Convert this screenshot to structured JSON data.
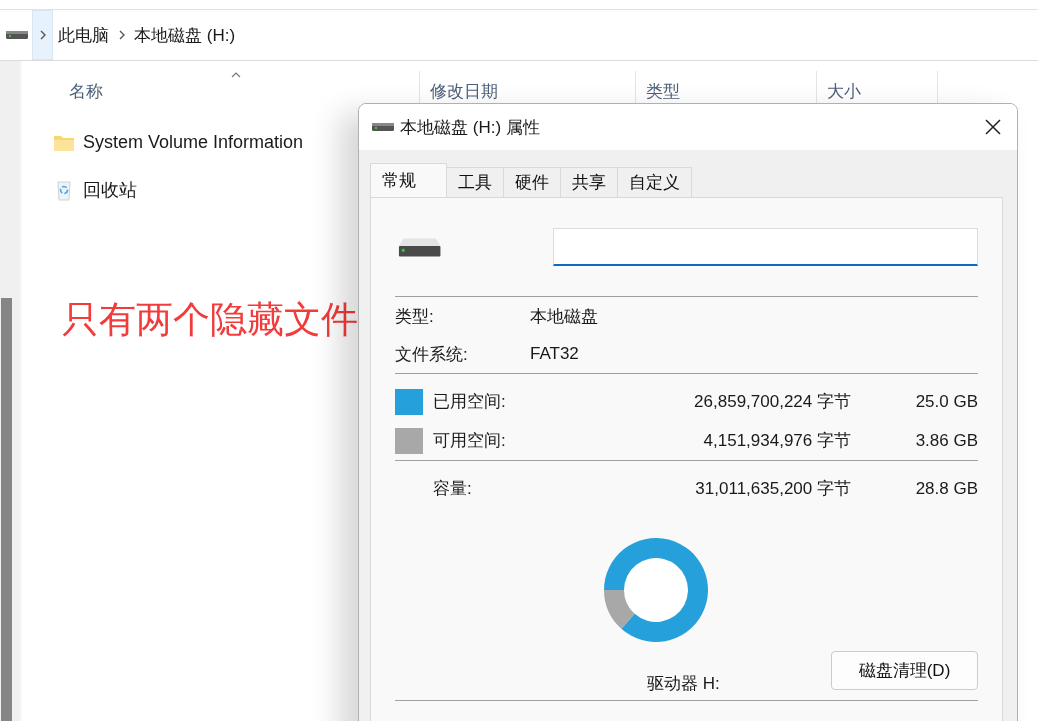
{
  "breadcrumb": {
    "items": [
      {
        "label": "此电脑"
      },
      {
        "label": "本地磁盘 (H:)"
      }
    ]
  },
  "file_list": {
    "columns": [
      {
        "label": "名称",
        "sorted": true
      },
      {
        "label": "修改日期",
        "sorted": false
      },
      {
        "label": "类型",
        "sorted": false
      },
      {
        "label": "大小",
        "sorted": false
      }
    ],
    "rows": [
      {
        "name": "System Volume Information",
        "kind": "folder"
      },
      {
        "name": "回收站",
        "kind": "recycle"
      }
    ]
  },
  "annotation": "只有两个隐藏文件",
  "dialog": {
    "title": "本地磁盘 (H:) 属性",
    "tabs": [
      {
        "label": "常规",
        "selected": true
      },
      {
        "label": "工具",
        "selected": false
      },
      {
        "label": "硬件",
        "selected": false
      },
      {
        "label": "共享",
        "selected": false
      },
      {
        "label": "自定义",
        "selected": false
      }
    ],
    "info": [
      {
        "label": "类型:",
        "value": "本地磁盘"
      },
      {
        "label": "文件系统:",
        "value": "FAT32"
      }
    ],
    "space": [
      {
        "label": "已用空间:",
        "bytes": "26,859,700,224 字节",
        "size": "25.0 GB",
        "color": "#26a0da"
      },
      {
        "label": "可用空间:",
        "bytes": "4,151,934,976 字节",
        "size": "3.86 GB",
        "color": "#a8a8a8"
      }
    ],
    "capacity": {
      "label": "容量:",
      "bytes": "31,011,635,200 字节",
      "size": "28.8 GB"
    },
    "drive_label": "驱动器 H:",
    "cleanup_button": "磁盘清理(D)"
  }
}
